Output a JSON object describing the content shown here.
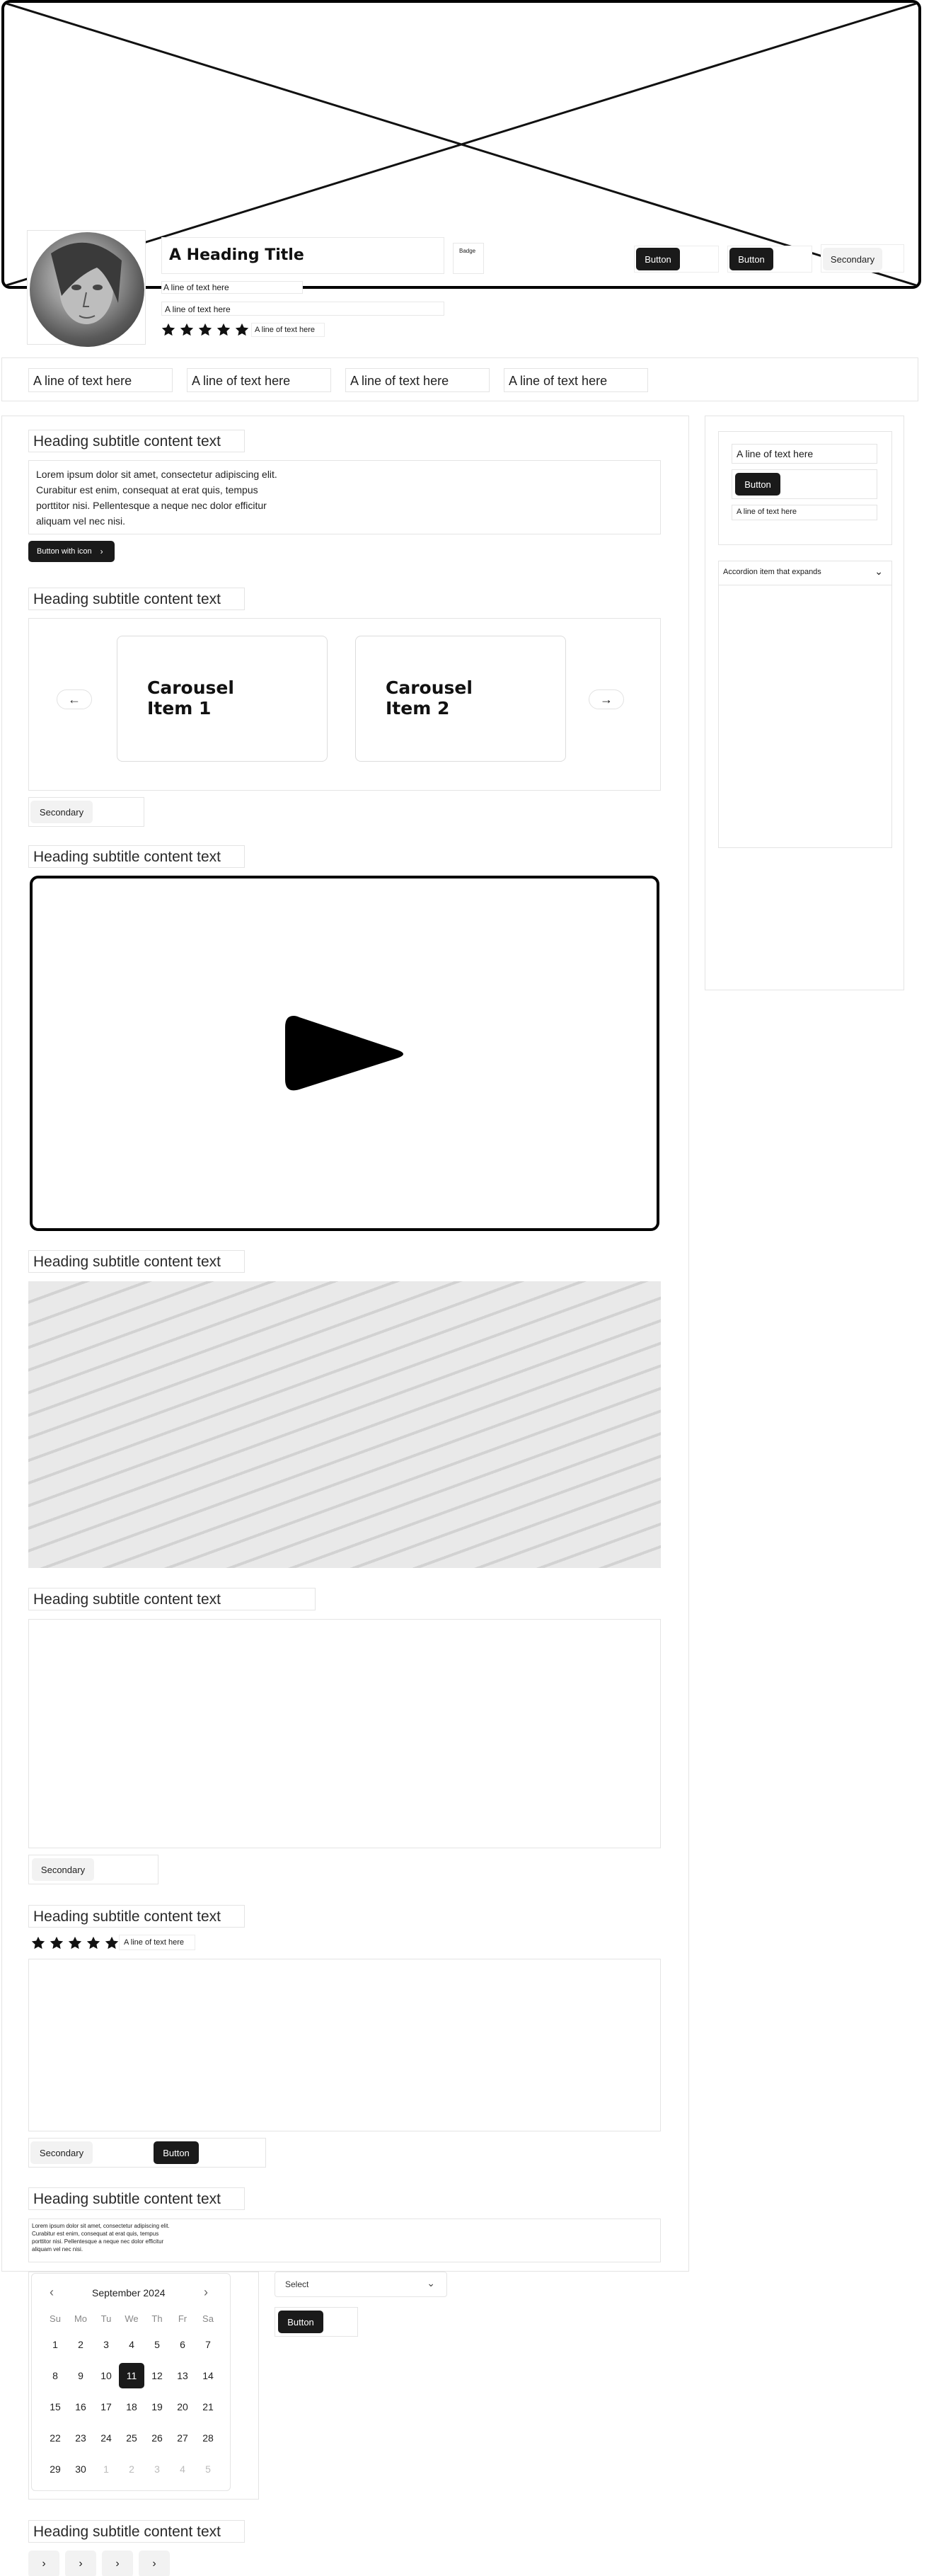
{
  "hero": {
    "heading": "A Heading Title",
    "badge": "Badge",
    "line1": "A line of text here",
    "line2": "A line of text here",
    "rating_text": "A line of text here",
    "button1": "Button",
    "button2": "Button",
    "secondary": "Secondary",
    "rating": 5
  },
  "nav": {
    "items": [
      "A line of text here",
      "A line of text here",
      "A line of text here",
      "A line of text here"
    ]
  },
  "sections": {
    "text_block": {
      "heading": "Heading subtitle content text",
      "paragraph": [
        "Lorem ipsum dolor sit amet, consectetur adipiscing elit.",
        "Curabitur est enim, consequat at erat quis, tempus",
        "porttitor nisi. Pellentesque a neque nec dolor efficitur",
        "aliquam vel nec nisi."
      ],
      "button": "Button with icon"
    },
    "carousel": {
      "heading": "Heading subtitle content text",
      "items": [
        "Carousel Item 1",
        "Carousel Item 2"
      ],
      "secondary": "Secondary"
    },
    "video": {
      "heading": "Heading subtitle content text"
    },
    "image": {
      "heading": "Heading subtitle content text"
    },
    "embed": {
      "heading": "Heading subtitle content text",
      "secondary": "Secondary"
    },
    "review": {
      "heading": "Heading subtitle content text",
      "rating_text": "A line of text here",
      "rating": 5,
      "secondary": "Secondary",
      "button": "Button"
    },
    "small_text": {
      "heading": "Heading subtitle content text",
      "paragraph": [
        "Lorem ipsum dolor sit amet, consectetur adipiscing elit.",
        "Curabitur est enim, consequat at erat quis, tempus",
        "porttitor nisi. Pellentesque a neque nec dolor efficitur",
        "aliquam vel nec nisi."
      ]
    },
    "pagination": {
      "heading": "Heading subtitle content text",
      "arrow": "›"
    }
  },
  "sidebar": {
    "line1": "A line of text here",
    "button": "Button",
    "line2": "A line of text here",
    "accordion": "Accordion item that expands"
  },
  "calendar": {
    "month": "September 2024",
    "prev": "‹",
    "next": "›",
    "dow": [
      "Su",
      "Mo",
      "Tu",
      "We",
      "Th",
      "Fr",
      "Sa"
    ],
    "weeks": [
      [
        "1",
        "2",
        "3",
        "4",
        "5",
        "6",
        "7"
      ],
      [
        "8",
        "9",
        "10",
        "11",
        "12",
        "13",
        "14"
      ],
      [
        "15",
        "16",
        "17",
        "18",
        "19",
        "20",
        "21"
      ],
      [
        "22",
        "23",
        "24",
        "25",
        "26",
        "27",
        "28"
      ],
      [
        "29",
        "30",
        "1",
        "2",
        "3",
        "4",
        "5"
      ]
    ],
    "selected": "11"
  },
  "form": {
    "select_value": "Select",
    "button": "Button"
  },
  "colors": {
    "dark": "#1a1a1a",
    "border": "#e4e4e4",
    "light": "#f2f2f2"
  }
}
